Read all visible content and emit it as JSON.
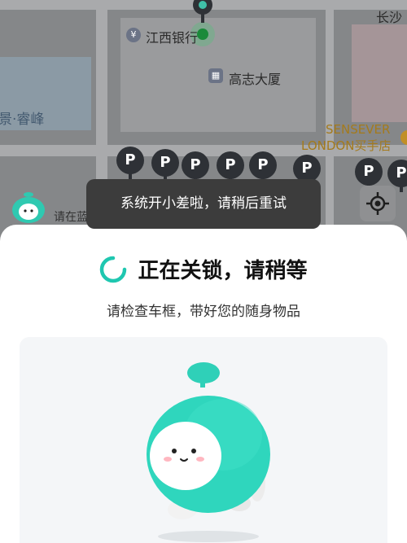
{
  "map": {
    "labels": {
      "changsha": "长沙",
      "bank": "江西银行",
      "building": "高志大厦",
      "jing_ruifeng": "景·睿峰",
      "sensever_line1": "SENSEVER",
      "sensever_line2": "LONDON买手店",
      "please_park": "请在蓝"
    },
    "poi_icons": {
      "bank": "yen-icon",
      "building": "building-icon"
    },
    "parking_label": "P",
    "parking_markers": [
      "P",
      "P",
      "P",
      "P",
      "P",
      "P",
      "P",
      "P"
    ]
  },
  "toast": {
    "message": "系统开小差啦，请稍后重试"
  },
  "sheet": {
    "title": "正在关锁，请稍等",
    "subtitle": "请检查车框，带好您的随身物品",
    "spinner_icon": "loading-spinner-icon"
  },
  "colors": {
    "accent": "#1fc7b0",
    "toast_bg": "#3c3c3c",
    "map_bg": "#858789"
  }
}
